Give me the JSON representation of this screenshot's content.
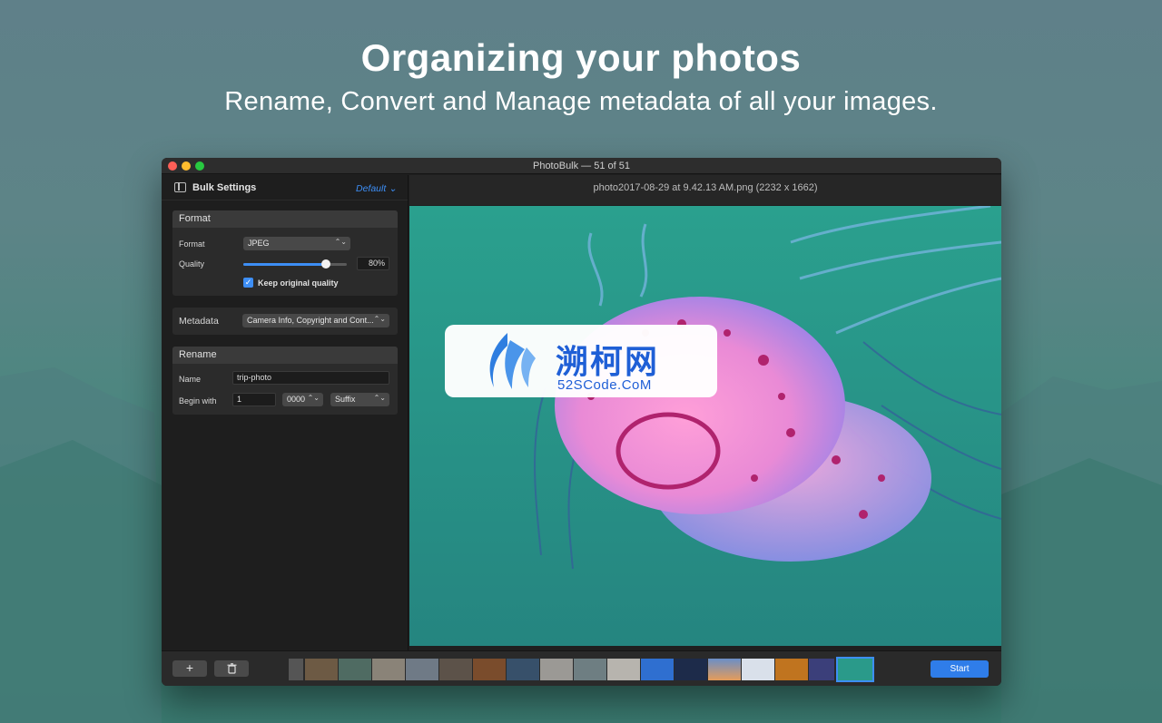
{
  "promo": {
    "title": "Organizing your photos",
    "subtitle": "Rename, Convert and Manage metadata of all your images."
  },
  "window": {
    "title": "PhotoBulk — 51 of 51"
  },
  "sidebar": {
    "title": "Bulk Settings",
    "preset": "Default",
    "format_panel": {
      "header": "Format",
      "format_label": "Format",
      "format_value": "JPEG",
      "quality_label": "Quality",
      "quality_value": "80%",
      "quality_level": 0.8,
      "keep_original_label": "Keep original quality",
      "keep_original_checked": true
    },
    "metadata_panel": {
      "label": "Metadata",
      "value": "Camera Info, Copyright and Cont..."
    },
    "rename_panel": {
      "header": "Rename",
      "name_label": "Name",
      "name_value": "trip-photo",
      "begin_label": "Begin with",
      "begin_value": "1",
      "digits_value": "0000",
      "position_value": "Suffix"
    }
  },
  "preview": {
    "filename": "photo2017-08-29 at 9.42.13 AM.png (2232 x 1662)"
  },
  "toolbar": {
    "add_label": "+",
    "start_label": "Start"
  },
  "watermark": {
    "title": "溯柯网",
    "subtitle": "52SCode.CoM"
  },
  "colors": {
    "accent": "#3d8ef5",
    "start_button": "#2f7de9"
  }
}
